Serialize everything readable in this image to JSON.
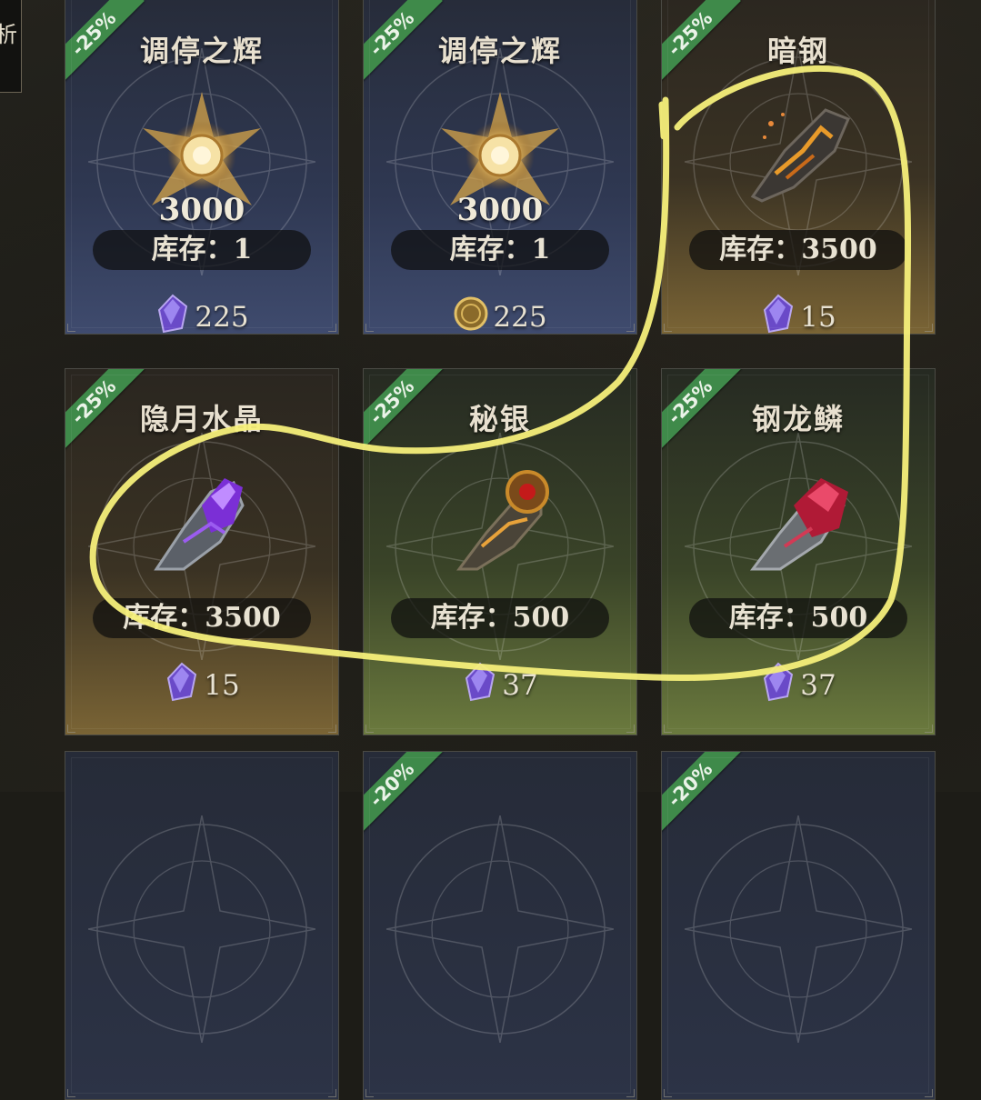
{
  "side_tab": {
    "label": "析"
  },
  "cards": [
    {
      "discount": "-25%",
      "name": "调停之辉",
      "amount": "3000",
      "stock": "库存：1",
      "price": "225",
      "currency_icon": "purple-crystal-icon",
      "item_icon": "radiant-star-icon",
      "theme": "blue"
    },
    {
      "discount": "-25%",
      "name": "调停之辉",
      "amount": "3000",
      "stock": "库存：1",
      "price": "225",
      "currency_icon": "gold-coin-icon",
      "item_icon": "radiant-star-icon",
      "theme": "blue"
    },
    {
      "discount": "-25%",
      "name": "暗钢",
      "amount": "",
      "stock": "库存：3500",
      "price": "15",
      "currency_icon": "purple-crystal-icon",
      "item_icon": "dark-steel-ore-icon",
      "theme": "brown"
    },
    {
      "discount": "-25%",
      "name": "隐月水晶",
      "amount": "",
      "stock": "库存：3500",
      "price": "15",
      "currency_icon": "purple-crystal-icon",
      "item_icon": "moon-crystal-ore-icon",
      "theme": "brown"
    },
    {
      "discount": "-25%",
      "name": "秘银",
      "amount": "",
      "stock": "库存：500",
      "price": "37",
      "currency_icon": "purple-crystal-icon",
      "item_icon": "mithril-ore-icon",
      "theme": "green"
    },
    {
      "discount": "-25%",
      "name": "钢龙鳞",
      "amount": "",
      "stock": "库存：500",
      "price": "37",
      "currency_icon": "purple-crystal-icon",
      "item_icon": "dragon-scale-ore-icon",
      "theme": "green"
    },
    {
      "discount": "",
      "name": "",
      "amount": "",
      "stock": "",
      "price": "",
      "currency_icon": "",
      "item_icon": "",
      "theme": "dark"
    },
    {
      "discount": "-20%",
      "name": "",
      "amount": "",
      "stock": "",
      "price": "",
      "currency_icon": "",
      "item_icon": "",
      "theme": "dark"
    },
    {
      "discount": "-20%",
      "name": "",
      "amount": "",
      "stock": "",
      "price": "",
      "currency_icon": "",
      "item_icon": "",
      "theme": "dark"
    }
  ],
  "colors": {
    "discount_ribbon": "#3f8a4a",
    "annotation": "#f6ef7a"
  }
}
